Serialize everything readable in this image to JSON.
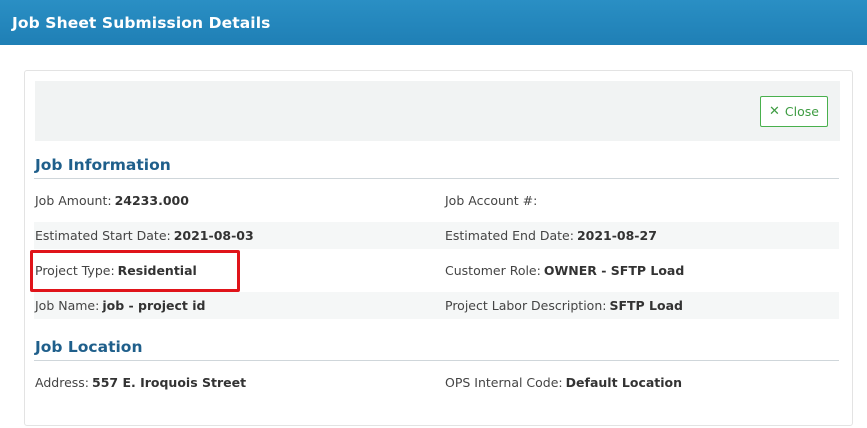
{
  "dialog": {
    "title": "Job Sheet Submission Details"
  },
  "toolbar": {
    "close_label": "Close",
    "close_icon": "close-x-icon",
    "accent": "#49b04d"
  },
  "sections": {
    "job_information": {
      "title": "Job Information",
      "rows": [
        {
          "left": {
            "label": "Job Amount:",
            "value": "24233.000"
          },
          "right": {
            "label": "Job Account #:",
            "value": ""
          }
        },
        {
          "left": {
            "label": "Estimated Start Date:",
            "value": "2021-08-03"
          },
          "right": {
            "label": "Estimated End Date:",
            "value": "2021-08-27"
          }
        },
        {
          "left": {
            "label": "Project Type:",
            "value": "Residential"
          },
          "right": {
            "label": "Customer Role:",
            "value": "OWNER - SFTP Load"
          }
        },
        {
          "left": {
            "label": "Job Name:",
            "value": "job - project id"
          },
          "right": {
            "label": "Project Labor Description:",
            "value": "SFTP Load"
          }
        }
      ]
    },
    "job_location": {
      "title": "Job Location",
      "rows": [
        {
          "left": {
            "label": "Address:",
            "value": "557 E. Iroquois Street"
          },
          "right": {
            "label": "OPS Internal Code:",
            "value": "Default Location"
          }
        }
      ]
    }
  },
  "colors": {
    "header": "#1f7fb5",
    "section_title": "#1f5f8b",
    "highlight": "#e0141a"
  }
}
